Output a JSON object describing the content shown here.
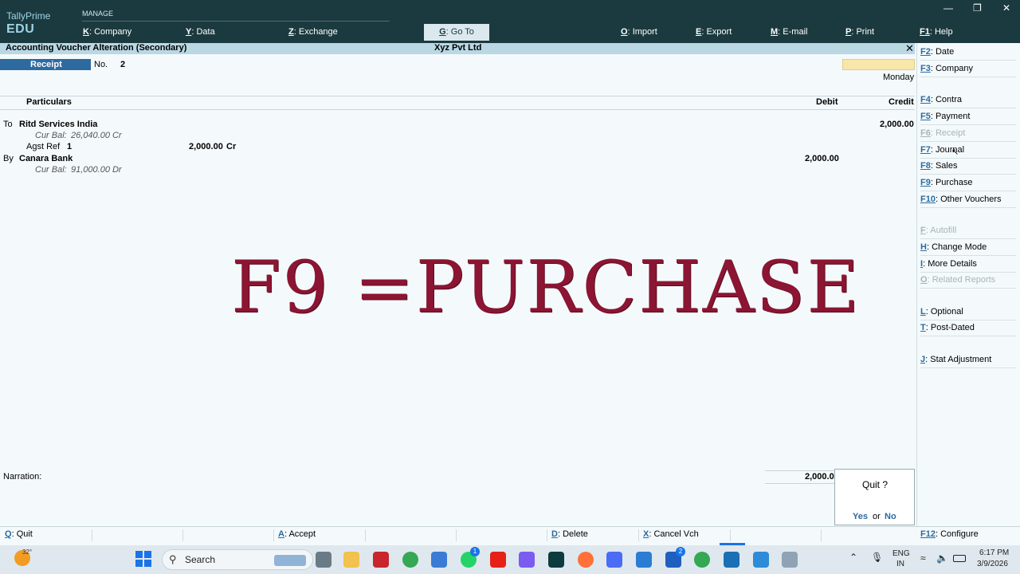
{
  "brand": {
    "line1": "TallyPrime",
    "line2": "EDU"
  },
  "topbar": {
    "section": "MANAGE",
    "menus": [
      {
        "key": "K",
        "label": "Company"
      },
      {
        "key": "Y",
        "label": "Data"
      },
      {
        "key": "Z",
        "label": "Exchange"
      },
      {
        "key": "G",
        "label": "Go To"
      },
      {
        "key": "O",
        "label": "Import"
      },
      {
        "key": "E",
        "label": "Export"
      },
      {
        "key": "M",
        "label": "E-mail"
      },
      {
        "key": "P",
        "label": "Print"
      },
      {
        "key": "F1",
        "label": "Help"
      }
    ]
  },
  "titlebar": {
    "title": "Accounting Voucher Alteration (Secondary)",
    "company": "Xyz Pvt Ltd",
    "close": "✕"
  },
  "voucher": {
    "type": "Receipt",
    "no_label": "No.",
    "no_value": "2",
    "day": "Monday",
    "columns": {
      "particulars": "Particulars",
      "debit": "Debit",
      "credit": "Credit"
    },
    "entries": [
      {
        "prefix": "To",
        "ledger": "Ritd Services India",
        "bal_label": "Cur Bal:",
        "bal_value": "26,040.00 Cr",
        "credit": "2,000.00",
        "ref_label": "Agst Ref",
        "ref_no": "1",
        "ref_amount": "2,000.00",
        "ref_drcr": "Cr"
      },
      {
        "prefix": "By",
        "ledger": "Canara Bank",
        "bal_label": "Cur Bal:",
        "bal_value": "91,000.00 Dr",
        "debit": "2,000.00"
      }
    ],
    "narration_label": "Narration:",
    "total": "2,000.0"
  },
  "overlay_text": "F9 =PURCHASE",
  "sidebar": [
    {
      "key": "F2",
      "label": "Date",
      "dim": false
    },
    {
      "key": "F3",
      "label": "Company",
      "dim": false
    },
    {
      "key": "F4",
      "label": "Contra",
      "dim": false
    },
    {
      "key": "F5",
      "label": "Payment",
      "dim": false
    },
    {
      "key": "F6",
      "label": "Receipt",
      "dim": true
    },
    {
      "key": "F7",
      "label": "Journal",
      "dim": false
    },
    {
      "key": "F8",
      "label": "Sales",
      "dim": false
    },
    {
      "key": "F9",
      "label": "Purchase",
      "dim": false
    },
    {
      "key": "F10",
      "label": "Other Vouchers",
      "dim": false
    },
    {
      "key": "F",
      "label": "Autofill",
      "dim": true
    },
    {
      "key": "H",
      "label": "Change Mode",
      "dim": false
    },
    {
      "key": "I",
      "label": "More Details",
      "dim": false
    },
    {
      "key": "O",
      "label": "Related Reports",
      "dim": true
    },
    {
      "key": "L",
      "label": "Optional",
      "dim": false
    },
    {
      "key": "T",
      "label": "Post-Dated",
      "dim": false
    },
    {
      "key": "J",
      "label": "Stat Adjustment",
      "dim": false
    }
  ],
  "quit_dialog": {
    "question": "Quit ?",
    "yes": "Yes",
    "or": "or",
    "no": "No"
  },
  "footer": [
    {
      "key": "Q",
      "label": "Quit"
    },
    {
      "key": "A",
      "label": "Accept"
    },
    {
      "key": "D",
      "label": "Delete"
    },
    {
      "key": "X",
      "label": "Cancel Vch"
    },
    {
      "key": "F12",
      "label": "Configure"
    }
  ],
  "taskbar": {
    "weather": "32°",
    "search": "Search",
    "lang1": "ENG",
    "lang2": "IN",
    "time": "6:17 PM",
    "date": "3/9/2026",
    "badge_whatsapp": "1",
    "badge_teams": "2"
  }
}
